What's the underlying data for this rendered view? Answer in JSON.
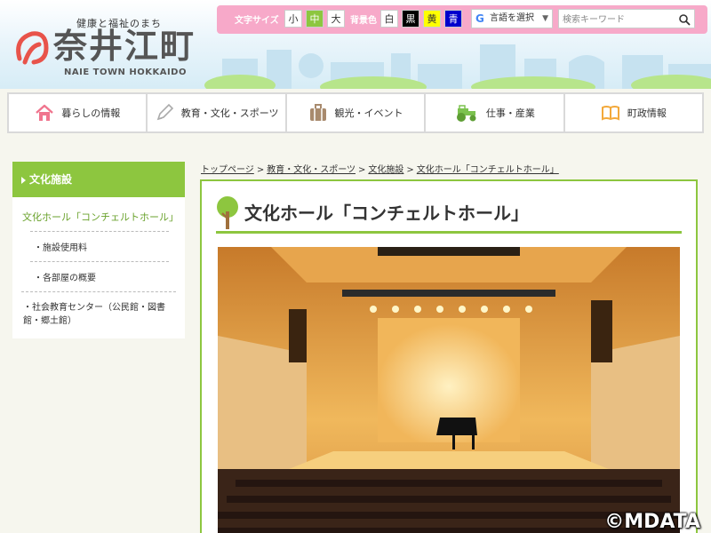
{
  "header": {
    "tagline": "健康と福祉のまち",
    "title": "奈井江町",
    "subtitle": "NAIE TOWN HOKKAIDO"
  },
  "toolbar": {
    "font_size_label": "文字サイズ",
    "font_sizes": [
      "小",
      "中",
      "大"
    ],
    "bg_label": "背景色",
    "bg_colors": [
      {
        "label": "白",
        "bg": "#ffffff",
        "fg": "#333333"
      },
      {
        "label": "黒",
        "bg": "#000000",
        "fg": "#ffffff"
      },
      {
        "label": "黄",
        "bg": "#ffff00",
        "fg": "#333333"
      },
      {
        "label": "青",
        "bg": "#0000cc",
        "fg": "#ffffff"
      }
    ],
    "translate_label": "言語を選択",
    "search_placeholder": "検索キーワード"
  },
  "nav": [
    {
      "label": "暮らしの情報",
      "icon": "house-icon"
    },
    {
      "label": "教育・文化・スポーツ",
      "icon": "pencil-icon"
    },
    {
      "label": "観光・イベント",
      "icon": "suitcase-icon"
    },
    {
      "label": "仕事・産業",
      "icon": "tractor-icon"
    },
    {
      "label": "町政情報",
      "icon": "book-icon"
    }
  ],
  "sidebar": {
    "heading": "文化施設",
    "active": "文化ホール「コンチェルトホール」",
    "subitems": [
      "施設使用料",
      "各部屋の概要"
    ],
    "other": "社会教育センター（公民館・図書館・郷土館）"
  },
  "breadcrumb": [
    "トップページ",
    "教育・文化・スポーツ",
    "文化施設",
    "文化ホール「コンチェルトホール」"
  ],
  "breadcrumb_sep": ">",
  "page": {
    "title": "文化ホール「コンチェルトホール」"
  },
  "watermark": "©MDATA",
  "colors": {
    "accent_green": "#8dc63f",
    "toolbar_pink": "#f7a9c9",
    "logo_red": "#e8534a"
  }
}
